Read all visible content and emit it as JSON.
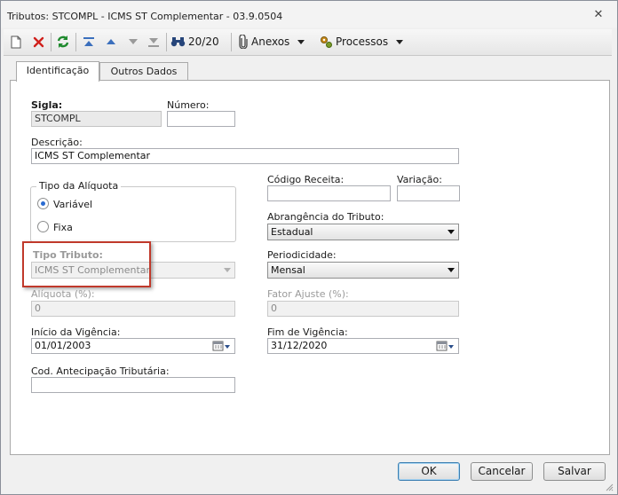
{
  "window": {
    "title": "Tributos: STCOMPL - ICMS ST Complementar - 03.9.0504"
  },
  "toolbar": {
    "icons": [
      "new-document-icon",
      "delete-icon",
      "refresh-icon",
      "first-record-icon",
      "previous-record-icon",
      "next-record-icon",
      "last-record-icon",
      "binoculars-icon",
      "attachment-icon",
      "gears-icon"
    ],
    "record_counter": "20/20",
    "attachments_label": "Anexos",
    "processes_label": "Processos"
  },
  "tabs": [
    {
      "label": "Identificação",
      "active": true
    },
    {
      "label": "Outros Dados",
      "active": false
    }
  ],
  "form": {
    "sigla": {
      "label": "Sigla:",
      "value": "STCOMPL"
    },
    "numero": {
      "label": "Número:",
      "value": ""
    },
    "descricao": {
      "label": "Descrição:",
      "value": "ICMS ST Complementar"
    },
    "tipo_aliquota": {
      "title": "Tipo da Alíquota",
      "options": [
        {
          "label": "Variável",
          "selected": true
        },
        {
          "label": "Fixa",
          "selected": false
        }
      ]
    },
    "codigo_receita": {
      "label": "Código Receita:",
      "value": ""
    },
    "variacao": {
      "label": "Variação:",
      "value": ""
    },
    "abrangencia": {
      "label": "Abrangência do Tributo:",
      "value": "Estadual"
    },
    "tipo_tributo": {
      "label": "Tipo Tributo:",
      "value": "ICMS ST Complementar"
    },
    "periodicidade": {
      "label": "Periodicidade:",
      "value": "Mensal"
    },
    "aliquota": {
      "label": "Alíquota (%):",
      "value": "0"
    },
    "fator_ajuste": {
      "label": "Fator Ajuste (%):",
      "value": "0"
    },
    "inicio_vigencia": {
      "label": "Início da Vigência:",
      "value": "01/01/2003"
    },
    "fim_vigencia": {
      "label": "Fim de Vigência:",
      "value": "31/12/2020"
    },
    "cod_antecipacao": {
      "label": "Cod. Antecipação Tributária:",
      "value": ""
    }
  },
  "buttons": {
    "ok": "OK",
    "cancel": "Cancelar",
    "save": "Salvar"
  },
  "colors": {
    "highlight": "#c0392b",
    "accent": "#2a6bd1"
  }
}
